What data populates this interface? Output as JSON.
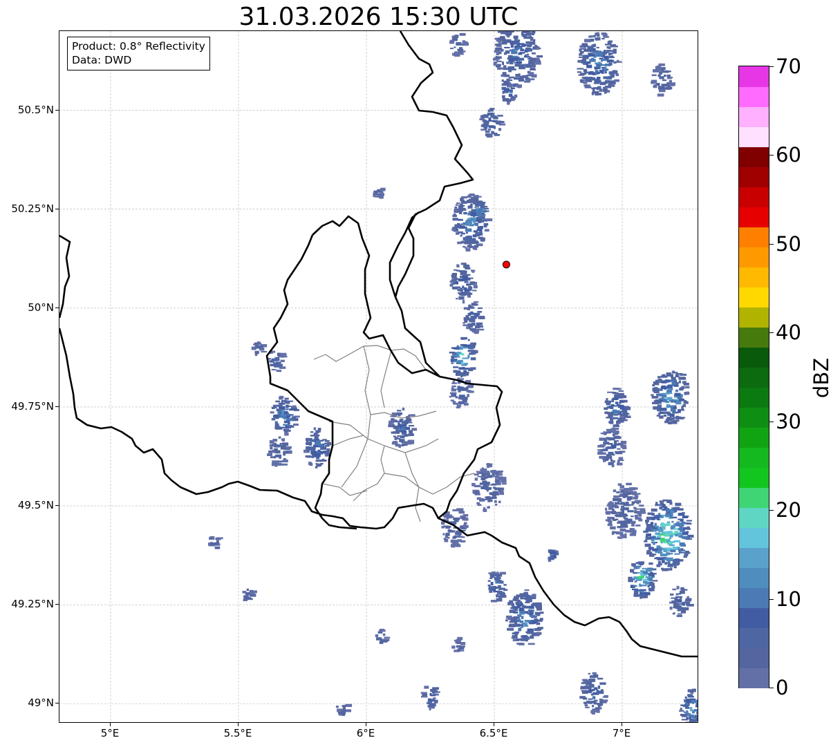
{
  "title": "31.03.2026 15:30 UTC",
  "info_box": {
    "product": "Product: 0.8° Reflectivity",
    "data_source": "Data: DWD"
  },
  "map": {
    "lon_range": [
      4.8,
      7.3
    ],
    "lat_range": [
      48.95,
      50.7
    ],
    "x_ticks": [
      {
        "value": 5.0,
        "label": "5°E"
      },
      {
        "value": 5.5,
        "label": "5.5°E"
      },
      {
        "value": 6.0,
        "label": "6°E"
      },
      {
        "value": 6.5,
        "label": "6.5°E"
      },
      {
        "value": 7.0,
        "label": "7°E"
      }
    ],
    "y_ticks": [
      {
        "value": 50.5,
        "label": "50.5°N"
      },
      {
        "value": 50.25,
        "label": "50.25°N"
      },
      {
        "value": 50.0,
        "label": "50°N"
      },
      {
        "value": 49.75,
        "label": "49.75°N"
      },
      {
        "value": 49.5,
        "label": "49.5°N"
      },
      {
        "value": 49.25,
        "label": "49.25°N"
      },
      {
        "value": 49.0,
        "label": "49°N"
      }
    ],
    "gridlines": true,
    "radar_site": {
      "lon": 6.547,
      "lat": 50.11,
      "color": "#ff0000"
    },
    "precip_cells": [
      {
        "lon": 6.04,
        "lat": 50.3,
        "r": 0.02,
        "max": 6
      },
      {
        "lon": 6.4,
        "lat": 50.22,
        "r": 0.07,
        "max": 18
      },
      {
        "lon": 6.43,
        "lat": 50.25,
        "r": 0.03,
        "max": 24
      },
      {
        "lon": 6.37,
        "lat": 50.07,
        "r": 0.05,
        "max": 14
      },
      {
        "lon": 6.41,
        "lat": 49.98,
        "r": 0.04,
        "max": 12
      },
      {
        "lon": 6.37,
        "lat": 49.88,
        "r": 0.05,
        "max": 28
      },
      {
        "lon": 6.36,
        "lat": 49.79,
        "r": 0.04,
        "max": 10
      },
      {
        "lon": 6.13,
        "lat": 49.7,
        "r": 0.05,
        "max": 12
      },
      {
        "lon": 5.67,
        "lat": 49.73,
        "r": 0.05,
        "max": 18
      },
      {
        "lon": 5.8,
        "lat": 49.65,
        "r": 0.05,
        "max": 16
      },
      {
        "lon": 5.65,
        "lat": 49.64,
        "r": 0.04,
        "max": 10
      },
      {
        "lon": 5.64,
        "lat": 49.87,
        "r": 0.03,
        "max": 10
      },
      {
        "lon": 6.47,
        "lat": 49.55,
        "r": 0.06,
        "max": 8
      },
      {
        "lon": 6.34,
        "lat": 49.45,
        "r": 0.05,
        "max": 8
      },
      {
        "lon": 6.48,
        "lat": 50.47,
        "r": 0.04,
        "max": 14
      },
      {
        "lon": 6.58,
        "lat": 50.65,
        "r": 0.09,
        "max": 14
      },
      {
        "lon": 6.55,
        "lat": 50.55,
        "r": 0.03,
        "max": 18
      },
      {
        "lon": 6.35,
        "lat": 50.67,
        "r": 0.03,
        "max": 8
      },
      {
        "lon": 6.9,
        "lat": 50.62,
        "r": 0.08,
        "max": 18
      },
      {
        "lon": 7.15,
        "lat": 50.58,
        "r": 0.04,
        "max": 8
      },
      {
        "lon": 7.18,
        "lat": 49.78,
        "r": 0.07,
        "max": 22
      },
      {
        "lon": 6.97,
        "lat": 49.75,
        "r": 0.05,
        "max": 14
      },
      {
        "lon": 6.95,
        "lat": 49.65,
        "r": 0.05,
        "max": 10
      },
      {
        "lon": 7.0,
        "lat": 49.49,
        "r": 0.07,
        "max": 8
      },
      {
        "lon": 7.17,
        "lat": 49.43,
        "r": 0.09,
        "max": 32
      },
      {
        "lon": 7.07,
        "lat": 49.32,
        "r": 0.05,
        "max": 30
      },
      {
        "lon": 7.22,
        "lat": 49.26,
        "r": 0.04,
        "max": 12
      },
      {
        "lon": 6.61,
        "lat": 49.22,
        "r": 0.07,
        "max": 18
      },
      {
        "lon": 6.5,
        "lat": 49.3,
        "r": 0.04,
        "max": 14
      },
      {
        "lon": 6.72,
        "lat": 49.38,
        "r": 0.02,
        "max": 14
      },
      {
        "lon": 6.88,
        "lat": 49.03,
        "r": 0.05,
        "max": 14
      },
      {
        "lon": 7.27,
        "lat": 48.99,
        "r": 0.05,
        "max": 20
      },
      {
        "lon": 6.24,
        "lat": 49.02,
        "r": 0.03,
        "max": 14
      },
      {
        "lon": 5.53,
        "lat": 49.28,
        "r": 0.02,
        "max": 8
      },
      {
        "lon": 5.4,
        "lat": 49.41,
        "r": 0.02,
        "max": 8
      },
      {
        "lon": 5.57,
        "lat": 49.9,
        "r": 0.02,
        "max": 8
      },
      {
        "lon": 5.9,
        "lat": 48.99,
        "r": 0.02,
        "max": 8
      },
      {
        "lon": 6.35,
        "lat": 49.15,
        "r": 0.02,
        "max": 8
      },
      {
        "lon": 6.05,
        "lat": 49.17,
        "r": 0.02,
        "max": 8
      }
    ]
  },
  "colorbar": {
    "unit": "dBZ",
    "min": 0,
    "max": 70,
    "step": 2.5,
    "ticks": [
      {
        "value": 0,
        "label": "0"
      },
      {
        "value": 10,
        "label": "10"
      },
      {
        "value": 20,
        "label": "20"
      },
      {
        "value": 30,
        "label": "30"
      },
      {
        "value": 40,
        "label": "40"
      },
      {
        "value": 50,
        "label": "50"
      },
      {
        "value": 60,
        "label": "60"
      },
      {
        "value": 70,
        "label": "70"
      }
    ],
    "colors": [
      "#6370a8",
      "#5465a0",
      "#4e66a2",
      "#425ca3",
      "#4b7ab5",
      "#4f8dbf",
      "#5aa1cc",
      "#63c5dc",
      "#5fd6c4",
      "#3fd575",
      "#12c61f",
      "#14b81f",
      "#11a412",
      "#0e8f13",
      "#0b7a11",
      "#0b6b0e",
      "#095a0a",
      "#477a0c",
      "#b0b300",
      "#ffd800",
      "#ffb900",
      "#ff9900",
      "#ff7f00",
      "#e60000",
      "#c90000",
      "#a00000",
      "#800000",
      "#ffe0ff",
      "#ffb0ff",
      "#ff6bff",
      "#e636e6"
    ]
  }
}
